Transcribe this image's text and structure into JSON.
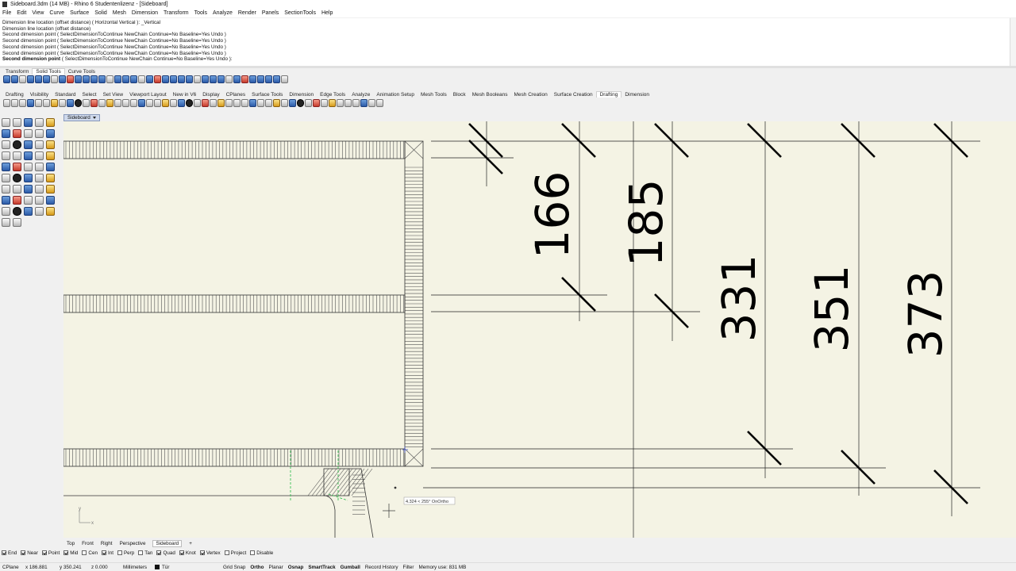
{
  "window": {
    "title": "Sideboard.3dm (14 MB) - Rhino 6 Studentenlizenz - [Sideboard]"
  },
  "menu": [
    "File",
    "Edit",
    "View",
    "Curve",
    "Surface",
    "Solid",
    "Mesh",
    "Dimension",
    "Transform",
    "Tools",
    "Analyze",
    "Render",
    "Panels",
    "SectionTools",
    "Help"
  ],
  "command_history": [
    "Dimension line location (offset distance) ( Horizontal  Vertical ): _Vertical",
    "Dimension line location (offset distance)",
    "Second dimension point ( SelectDimensionToContinue  NewChain  Continue=No  Baseline=Yes  Undo )",
    "Second dimension point ( SelectDimensionToContinue  NewChain  Continue=No  Baseline=Yes  Undo )",
    "Second dimension point ( SelectDimensionToContinue  NewChain  Continue=No  Baseline=Yes  Undo )",
    "Second dimension point ( SelectDimensionToContinue  NewChain  Continue=No  Baseline=Yes  Undo )"
  ],
  "command_prompt": {
    "label": "Second dimension point",
    "options": "( SelectDimensionToContinue  NewChain  Continue=No  Baseline=Yes  Undo ):"
  },
  "toolbar_tabs_top": [
    {
      "label": "Transform",
      "active": false
    },
    {
      "label": "Solid Tools",
      "active": true
    },
    {
      "label": "Curve Tools",
      "active": false
    }
  ],
  "toolbar_tabs_main": [
    {
      "label": "Drafting",
      "active": false
    },
    {
      "label": "Visibility",
      "active": false
    },
    {
      "label": "Standard",
      "active": false
    },
    {
      "label": "Select",
      "active": false
    },
    {
      "label": "Set View",
      "active": false
    },
    {
      "label": "Viewport Layout",
      "active": false
    },
    {
      "label": "New in V6",
      "active": false
    },
    {
      "label": "Display",
      "active": false
    },
    {
      "label": "CPlanes",
      "active": false
    },
    {
      "label": "Surface Tools",
      "active": false
    },
    {
      "label": "Dimension",
      "active": false
    },
    {
      "label": "Edge Tools",
      "active": false
    },
    {
      "label": "Analyze",
      "active": false
    },
    {
      "label": "Animation Setup",
      "active": false
    },
    {
      "label": "Mesh Tools",
      "active": false
    },
    {
      "label": "Block",
      "active": false
    },
    {
      "label": "Mesh Booleans",
      "active": false
    },
    {
      "label": "Mesh Creation",
      "active": false
    },
    {
      "label": "Surface Creation",
      "active": false
    },
    {
      "label": "Drafting",
      "active": true
    },
    {
      "label": "Dimension",
      "active": false
    }
  ],
  "viewport": {
    "name": "Sideboard",
    "dimensions": [
      "166",
      "185",
      "331",
      "351",
      "373"
    ],
    "cursor_tooltip": "4.324 < 255° OnOrtho",
    "axis_x": "x",
    "axis_y": "y"
  },
  "viewport_tabs": [
    {
      "label": "Top",
      "active": false
    },
    {
      "label": "Front",
      "active": false
    },
    {
      "label": "Right",
      "active": false
    },
    {
      "label": "Perspective",
      "active": false
    },
    {
      "label": "Sideboard",
      "active": true
    },
    {
      "label": "+",
      "active": false
    }
  ],
  "osnaps": [
    {
      "label": "End",
      "checked": true
    },
    {
      "label": "Near",
      "checked": true
    },
    {
      "label": "Point",
      "checked": true
    },
    {
      "label": "Mid",
      "checked": true
    },
    {
      "label": "Cen",
      "checked": false
    },
    {
      "label": "Int",
      "checked": true
    },
    {
      "label": "Perp",
      "checked": false
    },
    {
      "label": "Tan",
      "checked": false
    },
    {
      "label": "Quad",
      "checked": true
    },
    {
      "label": "Knot",
      "checked": true
    },
    {
      "label": "Vertex",
      "checked": true
    },
    {
      "label": "Project",
      "checked": false
    },
    {
      "label": "Disable",
      "checked": false
    }
  ],
  "status": {
    "cplane": "CPlane",
    "x": "x 186.881",
    "y": "y 350.241",
    "z": "z 0.000",
    "units": "Millimeters",
    "layer": "Tür",
    "grid_snap": "Grid Snap",
    "ortho": "Ortho",
    "planar": "Planar",
    "osnap": "Osnap",
    "smarttrack": "SmartTrack",
    "gumball": "Gumball",
    "record_history": "Record History",
    "filter": "Filter",
    "memory": "Memory use: 831 MB"
  }
}
